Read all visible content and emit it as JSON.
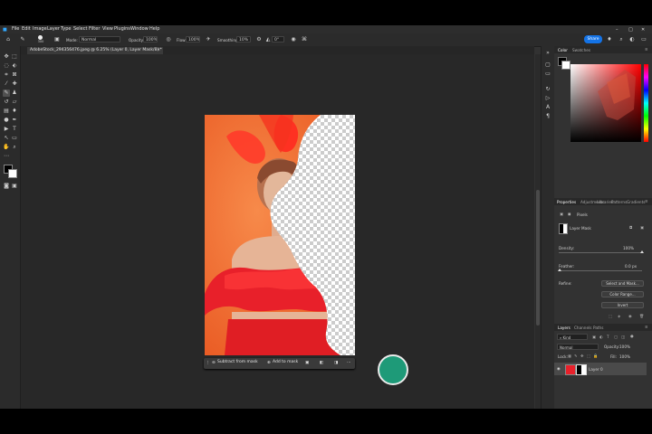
{
  "menu": [
    "File",
    "Edit",
    "Image",
    "Layer",
    "Type",
    "Select",
    "Filter",
    "View",
    "Plugins",
    "Window",
    "Help"
  ],
  "options": {
    "mode_label": "Mode:",
    "mode_value": "Normal",
    "opacity_label": "Opacity:",
    "opacity_value": "100%",
    "flow_label": "Flow:",
    "flow_value": "100%",
    "smoothing_label": "Smoothing:",
    "smoothing_value": "10%",
    "angle_value": "0°",
    "brush_size": "300",
    "share_label": "Share"
  },
  "document_tab": "AdobeStock_294356476.jpeg @ 6.25% (Layer 0, Layer Mask/8) *",
  "taskbar": {
    "subtract": "Subtract from mask",
    "add": "Add to mask"
  },
  "panels": {
    "color_tabs": [
      "Color",
      "Swatches"
    ],
    "properties_tabs": [
      "Properties",
      "Adjustments",
      "Libraries",
      "Patterns",
      "Gradients"
    ],
    "pixels_label": "Pixels",
    "layer_mask_label": "Layer Mask",
    "density_label": "Density:",
    "density_value": "100%",
    "feather_label": "Feather:",
    "feather_value": "0.0 px",
    "refine_label": "Refine:",
    "select_mask_button": "Select and Mask...",
    "color_range_button": "Color Range...",
    "invert_button": "Invert",
    "layers_tabs": [
      "Layers",
      "Channels",
      "Paths"
    ],
    "kind_label": "Kind",
    "blend_mode": "Normal",
    "opacity_label": "Opacity:",
    "opacity_value": "100%",
    "lock_label": "Lock:",
    "fill_label": "Fill:",
    "fill_value": "100%",
    "layer_name": "Layer 0"
  },
  "colors": {
    "accent": "#1473e6",
    "foreground": "#000000",
    "background": "#ffffff",
    "photo_bg": "#f26b2e",
    "dress": "#e8202a"
  },
  "density_fraction": 1.0,
  "feather_fraction": 0.0
}
